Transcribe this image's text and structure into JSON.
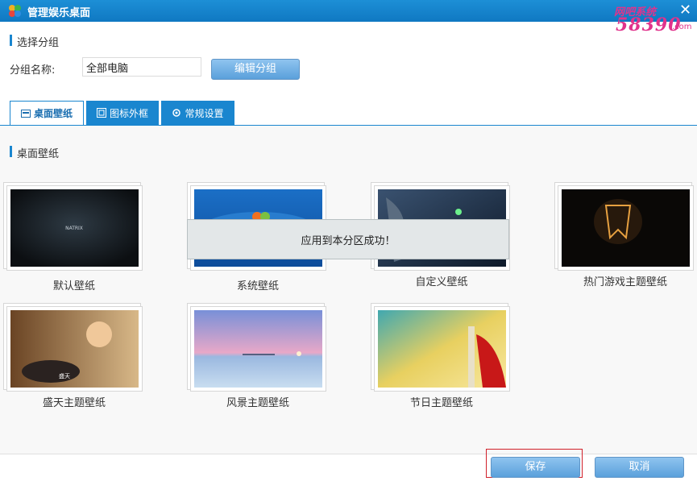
{
  "window": {
    "title": "管理娱乐桌面",
    "close_glyph": "✕"
  },
  "watermark": {
    "top": "网吧系统",
    "number": "58390",
    "suffix": ".com"
  },
  "group_section": {
    "title": "选择分组",
    "name_label": "分组名称:",
    "name_value": "全部电脑",
    "edit_button": "编辑分组"
  },
  "tabs": [
    {
      "label": "桌面壁纸",
      "icon": "wallpaper-icon",
      "active": true
    },
    {
      "label": "图标外框",
      "icon": "icon-frame-icon",
      "active": false
    },
    {
      "label": "常规设置",
      "icon": "gear-icon",
      "active": false
    }
  ],
  "wallpaper_section": {
    "title": "桌面壁纸",
    "items": [
      {
        "label": "默认壁纸",
        "thumb_text": "NATRIX"
      },
      {
        "label": "系统壁纸"
      },
      {
        "label": "自定义壁纸"
      },
      {
        "label": "热门游戏主题壁纸"
      },
      {
        "label": "盛天主题壁纸",
        "thumb_text": "盛天"
      },
      {
        "label": "风景主题壁纸"
      },
      {
        "label": "节日主题壁纸"
      }
    ]
  },
  "toast": {
    "message": "应用到本分区成功！"
  },
  "footer": {
    "save_button": "保存",
    "cancel_button": "取消"
  },
  "colors": {
    "accent": "#1a86cf",
    "highlight": "#d0202a"
  }
}
